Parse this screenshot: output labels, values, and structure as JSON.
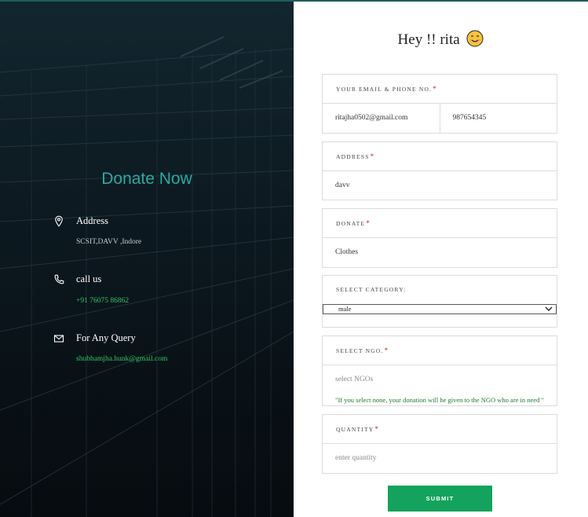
{
  "left_panel": {
    "title": "Donate Now",
    "address": {
      "heading": "Address",
      "value": "SCSIT,DAVV ,Indore"
    },
    "call": {
      "heading": "call us",
      "value": "+91 76075 86862"
    },
    "query": {
      "heading": "For Any Query",
      "value": "shubhamjha.hunk@gmail.com"
    }
  },
  "greeting": {
    "text": "Hey !! rita",
    "icon": "smiling-face-emoji"
  },
  "form": {
    "email_phone": {
      "label": "Your email & phone no.",
      "email": "ritajha0502@gmail.com",
      "phone": "987654345"
    },
    "address": {
      "label": "Address",
      "value": "davv"
    },
    "donate": {
      "label": "Donate",
      "value": "Clothes"
    },
    "category": {
      "label": "Select category:",
      "selected": "male"
    },
    "ngo": {
      "label": "Select NGO.",
      "placeholder": "select NGOs",
      "note": "\"If you select none, your donation will be given to the NGO who are in need \""
    },
    "quantity": {
      "label": "quantity",
      "placeholder": "enter quantity"
    },
    "required_mark": "*",
    "submit_label": "SUBMIT"
  },
  "colors": {
    "accent_teal": "#2aa9a2",
    "green": "#13a35c",
    "required": "#d11b1b"
  }
}
